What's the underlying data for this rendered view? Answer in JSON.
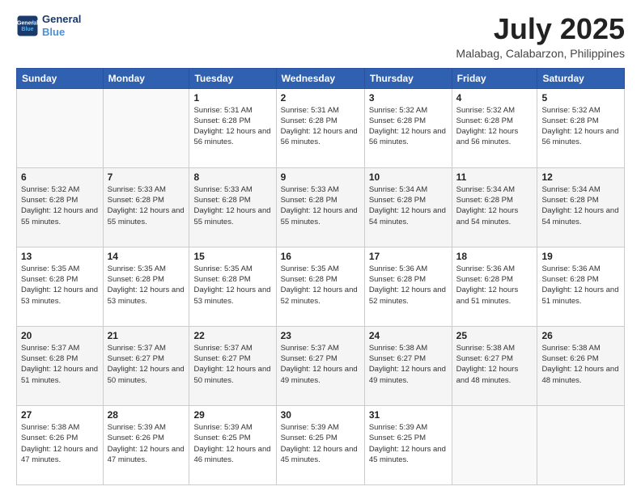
{
  "logo": {
    "line1": "General",
    "line2": "Blue"
  },
  "header": {
    "month": "July 2025",
    "location": "Malabag, Calabarzon, Philippines"
  },
  "weekdays": [
    "Sunday",
    "Monday",
    "Tuesday",
    "Wednesday",
    "Thursday",
    "Friday",
    "Saturday"
  ],
  "weeks": [
    [
      {
        "day": "",
        "info": ""
      },
      {
        "day": "",
        "info": ""
      },
      {
        "day": "1",
        "info": "Sunrise: 5:31 AM\nSunset: 6:28 PM\nDaylight: 12 hours and 56 minutes."
      },
      {
        "day": "2",
        "info": "Sunrise: 5:31 AM\nSunset: 6:28 PM\nDaylight: 12 hours and 56 minutes."
      },
      {
        "day": "3",
        "info": "Sunrise: 5:32 AM\nSunset: 6:28 PM\nDaylight: 12 hours and 56 minutes."
      },
      {
        "day": "4",
        "info": "Sunrise: 5:32 AM\nSunset: 6:28 PM\nDaylight: 12 hours and 56 minutes."
      },
      {
        "day": "5",
        "info": "Sunrise: 5:32 AM\nSunset: 6:28 PM\nDaylight: 12 hours and 56 minutes."
      }
    ],
    [
      {
        "day": "6",
        "info": "Sunrise: 5:32 AM\nSunset: 6:28 PM\nDaylight: 12 hours and 55 minutes."
      },
      {
        "day": "7",
        "info": "Sunrise: 5:33 AM\nSunset: 6:28 PM\nDaylight: 12 hours and 55 minutes."
      },
      {
        "day": "8",
        "info": "Sunrise: 5:33 AM\nSunset: 6:28 PM\nDaylight: 12 hours and 55 minutes."
      },
      {
        "day": "9",
        "info": "Sunrise: 5:33 AM\nSunset: 6:28 PM\nDaylight: 12 hours and 55 minutes."
      },
      {
        "day": "10",
        "info": "Sunrise: 5:34 AM\nSunset: 6:28 PM\nDaylight: 12 hours and 54 minutes."
      },
      {
        "day": "11",
        "info": "Sunrise: 5:34 AM\nSunset: 6:28 PM\nDaylight: 12 hours and 54 minutes."
      },
      {
        "day": "12",
        "info": "Sunrise: 5:34 AM\nSunset: 6:28 PM\nDaylight: 12 hours and 54 minutes."
      }
    ],
    [
      {
        "day": "13",
        "info": "Sunrise: 5:35 AM\nSunset: 6:28 PM\nDaylight: 12 hours and 53 minutes."
      },
      {
        "day": "14",
        "info": "Sunrise: 5:35 AM\nSunset: 6:28 PM\nDaylight: 12 hours and 53 minutes."
      },
      {
        "day": "15",
        "info": "Sunrise: 5:35 AM\nSunset: 6:28 PM\nDaylight: 12 hours and 53 minutes."
      },
      {
        "day": "16",
        "info": "Sunrise: 5:35 AM\nSunset: 6:28 PM\nDaylight: 12 hours and 52 minutes."
      },
      {
        "day": "17",
        "info": "Sunrise: 5:36 AM\nSunset: 6:28 PM\nDaylight: 12 hours and 52 minutes."
      },
      {
        "day": "18",
        "info": "Sunrise: 5:36 AM\nSunset: 6:28 PM\nDaylight: 12 hours and 51 minutes."
      },
      {
        "day": "19",
        "info": "Sunrise: 5:36 AM\nSunset: 6:28 PM\nDaylight: 12 hours and 51 minutes."
      }
    ],
    [
      {
        "day": "20",
        "info": "Sunrise: 5:37 AM\nSunset: 6:28 PM\nDaylight: 12 hours and 51 minutes."
      },
      {
        "day": "21",
        "info": "Sunrise: 5:37 AM\nSunset: 6:27 PM\nDaylight: 12 hours and 50 minutes."
      },
      {
        "day": "22",
        "info": "Sunrise: 5:37 AM\nSunset: 6:27 PM\nDaylight: 12 hours and 50 minutes."
      },
      {
        "day": "23",
        "info": "Sunrise: 5:37 AM\nSunset: 6:27 PM\nDaylight: 12 hours and 49 minutes."
      },
      {
        "day": "24",
        "info": "Sunrise: 5:38 AM\nSunset: 6:27 PM\nDaylight: 12 hours and 49 minutes."
      },
      {
        "day": "25",
        "info": "Sunrise: 5:38 AM\nSunset: 6:27 PM\nDaylight: 12 hours and 48 minutes."
      },
      {
        "day": "26",
        "info": "Sunrise: 5:38 AM\nSunset: 6:26 PM\nDaylight: 12 hours and 48 minutes."
      }
    ],
    [
      {
        "day": "27",
        "info": "Sunrise: 5:38 AM\nSunset: 6:26 PM\nDaylight: 12 hours and 47 minutes."
      },
      {
        "day": "28",
        "info": "Sunrise: 5:39 AM\nSunset: 6:26 PM\nDaylight: 12 hours and 47 minutes."
      },
      {
        "day": "29",
        "info": "Sunrise: 5:39 AM\nSunset: 6:25 PM\nDaylight: 12 hours and 46 minutes."
      },
      {
        "day": "30",
        "info": "Sunrise: 5:39 AM\nSunset: 6:25 PM\nDaylight: 12 hours and 45 minutes."
      },
      {
        "day": "31",
        "info": "Sunrise: 5:39 AM\nSunset: 6:25 PM\nDaylight: 12 hours and 45 minutes."
      },
      {
        "day": "",
        "info": ""
      },
      {
        "day": "",
        "info": ""
      }
    ]
  ]
}
